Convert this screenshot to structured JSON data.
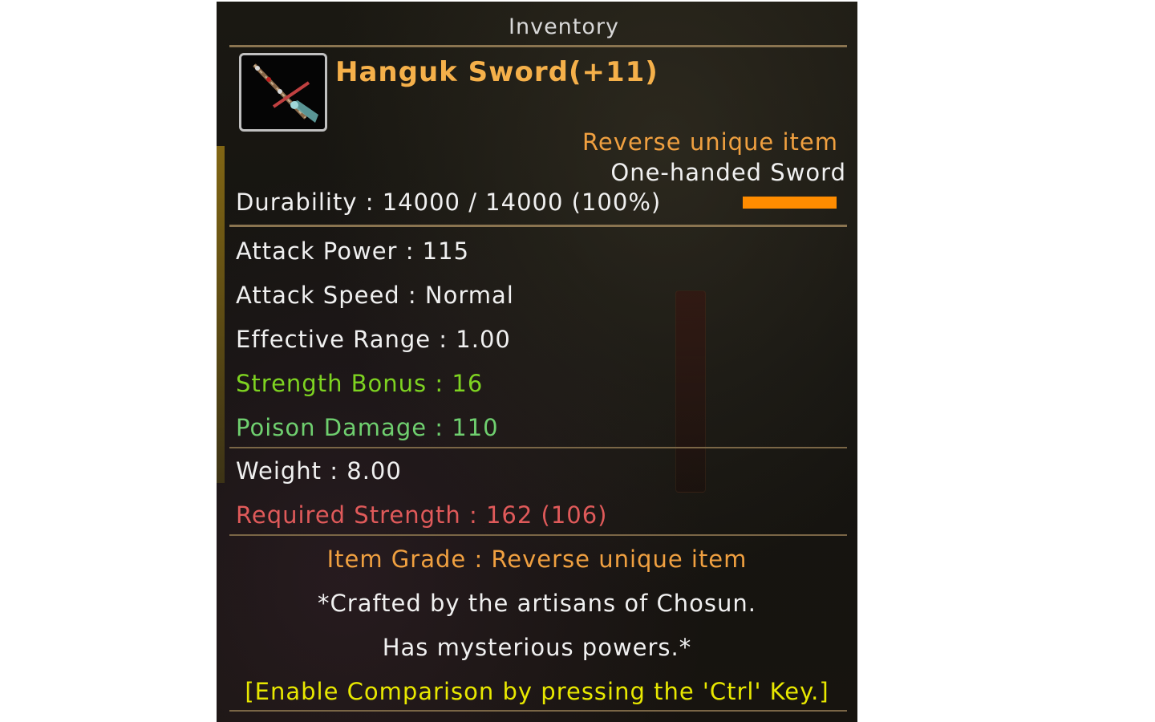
{
  "window": {
    "title": "Inventory"
  },
  "item": {
    "icon": "sword-icon",
    "name": "Hanguk Sword(+11)",
    "rarity": "Reverse unique item",
    "type": "One-handed Sword",
    "durability_text": "Durability : 14000 / 14000 (100%)",
    "durability_fraction": 1.0
  },
  "stats": {
    "attack_power": "Attack Power : 115",
    "attack_speed": "Attack Speed : Normal",
    "effective_range": "Effective Range : 1.00",
    "strength_bonus": "Strength Bonus : 16",
    "poison_damage": "Poison Damage : 110"
  },
  "requirements": {
    "weight": "Weight : 8.00",
    "required_strength": "Required Strength : 162 (106)"
  },
  "footer": {
    "item_grade": "Item Grade : Reverse unique item",
    "description_1": "*Crafted by the artisans of Chosun.",
    "description_2": "Has mysterious powers.*",
    "comparison_hint": "[Enable Comparison by pressing the 'Ctrl' Key.]"
  },
  "colors": {
    "item_name": "#f5b04a",
    "rarity": "#f0a040",
    "bonus_green": "#7ed321",
    "poison_green": "#6fcf6f",
    "required_red": "#e05a5a",
    "grade_orange": "#f0a040",
    "hint_yellow": "#e8e800",
    "durability_bar": "#ff8c00"
  }
}
